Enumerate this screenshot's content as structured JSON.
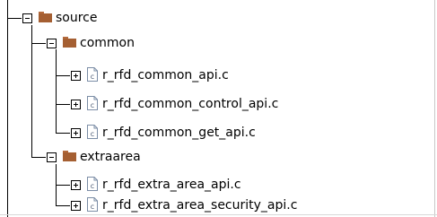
{
  "tree": {
    "nodes": [
      {
        "label": "source",
        "type": "folder",
        "state": "expanded",
        "icon": "folder-icon"
      },
      {
        "label": "common",
        "type": "folder",
        "state": "expanded",
        "icon": "folder-icon"
      },
      {
        "label": "r_rfd_common_api.c",
        "type": "file",
        "state": "collapsed",
        "icon": "c-file-icon"
      },
      {
        "label": "r_rfd_common_control_api.c",
        "type": "file",
        "state": "collapsed",
        "icon": "c-file-icon"
      },
      {
        "label": "r_rfd_common_get_api.c",
        "type": "file",
        "state": "collapsed",
        "icon": "c-file-icon"
      },
      {
        "label": "extraarea",
        "type": "folder",
        "state": "expanded",
        "icon": "folder-icon"
      },
      {
        "label": "r_rfd_extra_area_api.c",
        "type": "file",
        "state": "collapsed",
        "icon": "c-file-icon"
      },
      {
        "label": "r_rfd_extra_area_security_api.c",
        "type": "file",
        "state": "collapsed",
        "icon": "c-file-icon"
      }
    ]
  },
  "colors": {
    "background": "#ffffff",
    "tree_lines": "#000000",
    "folder": "#a55f32",
    "file_icon_border": "#7b8da6"
  }
}
